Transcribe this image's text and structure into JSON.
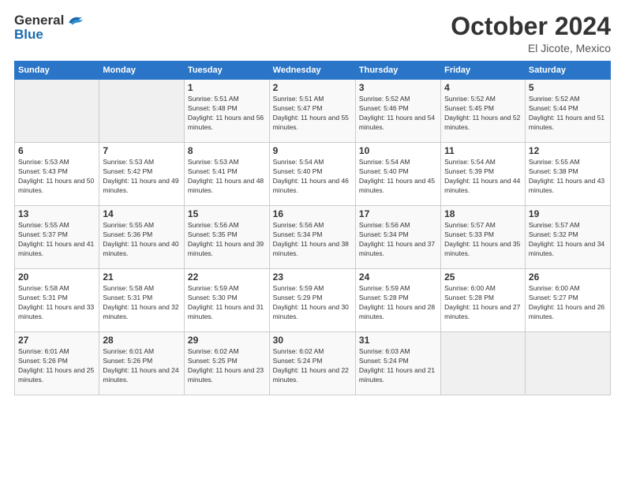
{
  "header": {
    "logo": {
      "general": "General",
      "blue": "Blue",
      "alt": "GeneralBlue logo"
    },
    "title": "October 2024",
    "subtitle": "El Jicote, Mexico"
  },
  "weekdays": [
    "Sunday",
    "Monday",
    "Tuesday",
    "Wednesday",
    "Thursday",
    "Friday",
    "Saturday"
  ],
  "weeks": [
    [
      {
        "day": "",
        "info": ""
      },
      {
        "day": "",
        "info": ""
      },
      {
        "day": "1",
        "info": "Sunrise: 5:51 AM\nSunset: 5:48 PM\nDaylight: 11 hours and 56 minutes."
      },
      {
        "day": "2",
        "info": "Sunrise: 5:51 AM\nSunset: 5:47 PM\nDaylight: 11 hours and 55 minutes."
      },
      {
        "day": "3",
        "info": "Sunrise: 5:52 AM\nSunset: 5:46 PM\nDaylight: 11 hours and 54 minutes."
      },
      {
        "day": "4",
        "info": "Sunrise: 5:52 AM\nSunset: 5:45 PM\nDaylight: 11 hours and 52 minutes."
      },
      {
        "day": "5",
        "info": "Sunrise: 5:52 AM\nSunset: 5:44 PM\nDaylight: 11 hours and 51 minutes."
      }
    ],
    [
      {
        "day": "6",
        "info": "Sunrise: 5:53 AM\nSunset: 5:43 PM\nDaylight: 11 hours and 50 minutes."
      },
      {
        "day": "7",
        "info": "Sunrise: 5:53 AM\nSunset: 5:42 PM\nDaylight: 11 hours and 49 minutes."
      },
      {
        "day": "8",
        "info": "Sunrise: 5:53 AM\nSunset: 5:41 PM\nDaylight: 11 hours and 48 minutes."
      },
      {
        "day": "9",
        "info": "Sunrise: 5:54 AM\nSunset: 5:40 PM\nDaylight: 11 hours and 46 minutes."
      },
      {
        "day": "10",
        "info": "Sunrise: 5:54 AM\nSunset: 5:40 PM\nDaylight: 11 hours and 45 minutes."
      },
      {
        "day": "11",
        "info": "Sunrise: 5:54 AM\nSunset: 5:39 PM\nDaylight: 11 hours and 44 minutes."
      },
      {
        "day": "12",
        "info": "Sunrise: 5:55 AM\nSunset: 5:38 PM\nDaylight: 11 hours and 43 minutes."
      }
    ],
    [
      {
        "day": "13",
        "info": "Sunrise: 5:55 AM\nSunset: 5:37 PM\nDaylight: 11 hours and 41 minutes."
      },
      {
        "day": "14",
        "info": "Sunrise: 5:55 AM\nSunset: 5:36 PM\nDaylight: 11 hours and 40 minutes."
      },
      {
        "day": "15",
        "info": "Sunrise: 5:56 AM\nSunset: 5:35 PM\nDaylight: 11 hours and 39 minutes."
      },
      {
        "day": "16",
        "info": "Sunrise: 5:56 AM\nSunset: 5:34 PM\nDaylight: 11 hours and 38 minutes."
      },
      {
        "day": "17",
        "info": "Sunrise: 5:56 AM\nSunset: 5:34 PM\nDaylight: 11 hours and 37 minutes."
      },
      {
        "day": "18",
        "info": "Sunrise: 5:57 AM\nSunset: 5:33 PM\nDaylight: 11 hours and 35 minutes."
      },
      {
        "day": "19",
        "info": "Sunrise: 5:57 AM\nSunset: 5:32 PM\nDaylight: 11 hours and 34 minutes."
      }
    ],
    [
      {
        "day": "20",
        "info": "Sunrise: 5:58 AM\nSunset: 5:31 PM\nDaylight: 11 hours and 33 minutes."
      },
      {
        "day": "21",
        "info": "Sunrise: 5:58 AM\nSunset: 5:31 PM\nDaylight: 11 hours and 32 minutes."
      },
      {
        "day": "22",
        "info": "Sunrise: 5:59 AM\nSunset: 5:30 PM\nDaylight: 11 hours and 31 minutes."
      },
      {
        "day": "23",
        "info": "Sunrise: 5:59 AM\nSunset: 5:29 PM\nDaylight: 11 hours and 30 minutes."
      },
      {
        "day": "24",
        "info": "Sunrise: 5:59 AM\nSunset: 5:28 PM\nDaylight: 11 hours and 28 minutes."
      },
      {
        "day": "25",
        "info": "Sunrise: 6:00 AM\nSunset: 5:28 PM\nDaylight: 11 hours and 27 minutes."
      },
      {
        "day": "26",
        "info": "Sunrise: 6:00 AM\nSunset: 5:27 PM\nDaylight: 11 hours and 26 minutes."
      }
    ],
    [
      {
        "day": "27",
        "info": "Sunrise: 6:01 AM\nSunset: 5:26 PM\nDaylight: 11 hours and 25 minutes."
      },
      {
        "day": "28",
        "info": "Sunrise: 6:01 AM\nSunset: 5:26 PM\nDaylight: 11 hours and 24 minutes."
      },
      {
        "day": "29",
        "info": "Sunrise: 6:02 AM\nSunset: 5:25 PM\nDaylight: 11 hours and 23 minutes."
      },
      {
        "day": "30",
        "info": "Sunrise: 6:02 AM\nSunset: 5:24 PM\nDaylight: 11 hours and 22 minutes."
      },
      {
        "day": "31",
        "info": "Sunrise: 6:03 AM\nSunset: 5:24 PM\nDaylight: 11 hours and 21 minutes."
      },
      {
        "day": "",
        "info": ""
      },
      {
        "day": "",
        "info": ""
      }
    ]
  ]
}
